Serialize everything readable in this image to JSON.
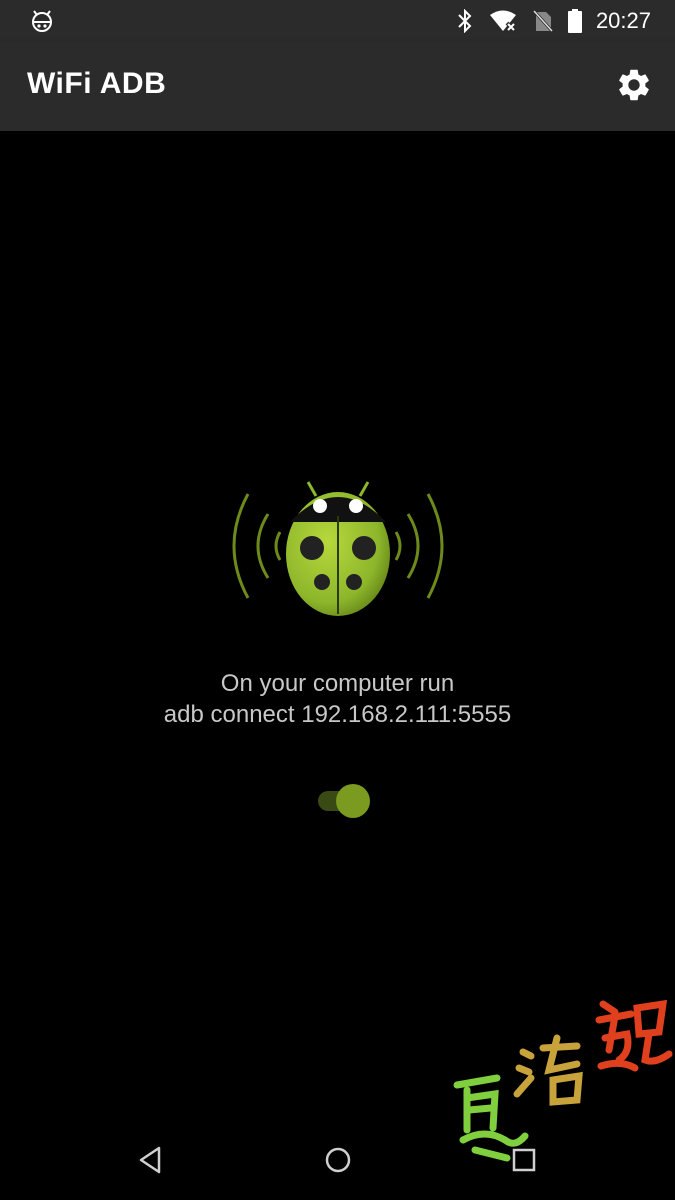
{
  "status_bar": {
    "time": "20:27",
    "icons": [
      "bug-notification-icon",
      "bluetooth-icon",
      "wifi-off-icon",
      "no-sim-icon",
      "battery-icon"
    ]
  },
  "app_bar": {
    "title": "WiFi ADB",
    "settings_icon": "gear-icon"
  },
  "main": {
    "logo": "ladybug-wifi-logo",
    "instruction_line1": "On your computer run",
    "instruction_line2": "adb connect 192.168.2.111:5555",
    "toggle_on": true,
    "accent_color": "#8db62b"
  },
  "watermark": {
    "text": "夏洛魂",
    "colors": [
      "#7fcf3f",
      "#c8a23a",
      "#e0401e"
    ]
  },
  "nav_bar": {
    "buttons": [
      "back-icon",
      "home-icon",
      "recents-icon"
    ]
  }
}
